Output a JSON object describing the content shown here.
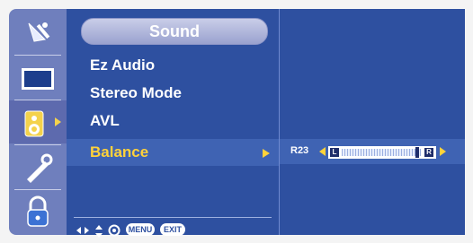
{
  "menu": {
    "title": "Sound",
    "items": [
      {
        "label": "Ez Audio"
      },
      {
        "label": "Stereo Mode"
      },
      {
        "label": "AVL"
      },
      {
        "label": "Balance"
      }
    ],
    "selected_index": 3
  },
  "sidebar": {
    "icons": [
      "picture-satellite-icon",
      "screen-icon",
      "speaker-icon",
      "tools-icon",
      "lock-icon"
    ],
    "selected_index": 2
  },
  "balance": {
    "value_text": "R23",
    "left_label": "L",
    "right_label": "R",
    "level": 0.96
  },
  "bottom_bar": {
    "menu_label": "MENU",
    "exit_label": "EXIT"
  },
  "colors": {
    "panel": "#2e50a0",
    "sidebar": "#6f7fbd",
    "highlight": "#ffd23a"
  }
}
